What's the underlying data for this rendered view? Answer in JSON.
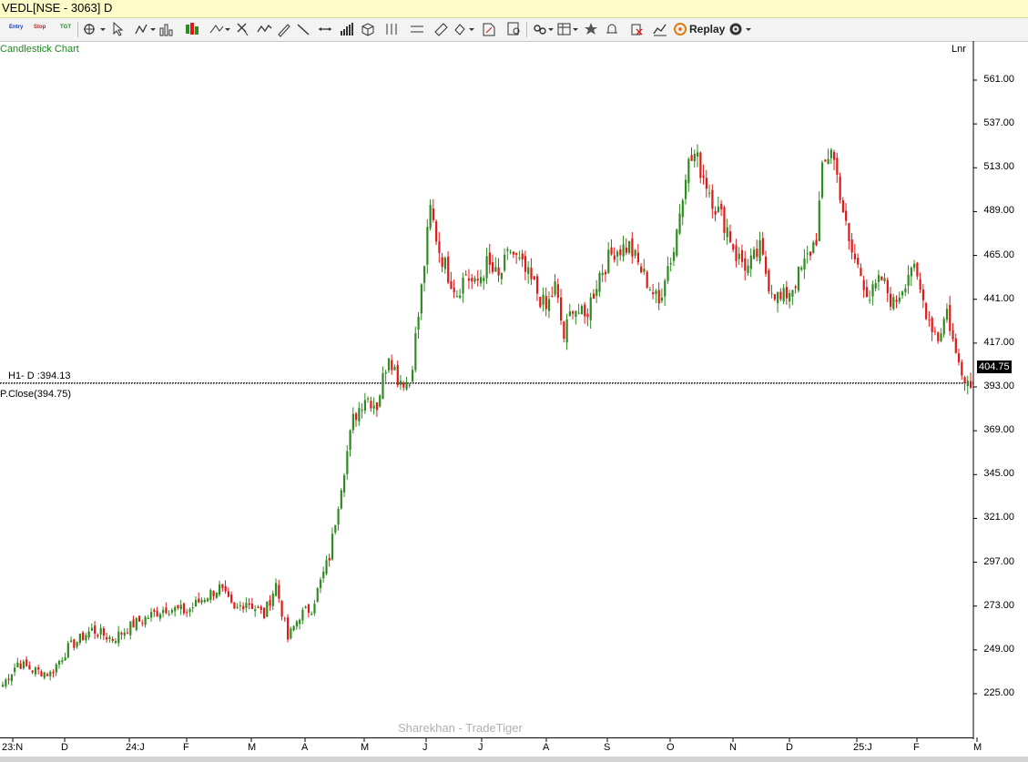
{
  "window": {
    "title": "VEDL[NSE - 3063] D"
  },
  "toolbar": {
    "buttons": [
      {
        "name": "entry-button",
        "label": "Entry",
        "color": "#1c3fa6"
      },
      {
        "name": "stop-button",
        "label": "Stop",
        "color": "#c62020"
      },
      {
        "name": "tgt-button",
        "label": "TGT",
        "color": "#1c8c2a"
      }
    ],
    "icons": [
      "crosshair-icon",
      "pointer-icon",
      "bar-type-icon",
      "chart-bars-icon",
      "candles-icon",
      "line-tools-icon",
      "cursor-icon",
      "zigzag-icon",
      "pencil-icon",
      "trendline-icon",
      "horizontal-line-icon",
      "volume-icon",
      "cube-icon",
      "fibonacci-icon",
      "parallel-lines-icon",
      "ruler-icon",
      "paint-icon",
      "text-tool-icon",
      "zoom-icon",
      "link-icon",
      "layout-icon",
      "favorite-icon",
      "alert-icon",
      "delete-icon",
      "indicator-icon"
    ],
    "replay_label": "Replay"
  },
  "chart": {
    "title": "Candlestick Chart",
    "scale_mode": "Lnr",
    "last_price": "404.75",
    "hline_label": "H1- D :394.13",
    "pclose_label": "P.Close(394.75)",
    "watermark": "Sharekhan - TradeTiger",
    "up_color": "#2e8b20",
    "down_color": "#e01818"
  },
  "chart_data": {
    "type": "candlestick",
    "title": "Candlestick Chart",
    "y_ticks": [
      "561.00",
      "537.00",
      "513.00",
      "489.00",
      "465.00",
      "441.00",
      "417.00",
      "393.00",
      "369.00",
      "345.00",
      "321.00",
      "297.00",
      "273.00",
      "249.00",
      "225.00"
    ],
    "ylim": [
      209,
      575
    ],
    "x_ticks": [
      "23:N",
      "D",
      "24:J",
      "F",
      "M",
      "A",
      "M",
      "J",
      "J",
      "A",
      "S",
      "O",
      "N",
      "D",
      "25:J",
      "F",
      "M"
    ],
    "last_price": 404.75,
    "h1_level": 394.13,
    "previous_close": 394.75,
    "anchors": [
      [
        0,
        230
      ],
      [
        5,
        242
      ],
      [
        10,
        238
      ],
      [
        16,
        236
      ],
      [
        22,
        250
      ],
      [
        30,
        260
      ],
      [
        37,
        255
      ],
      [
        44,
        263
      ],
      [
        50,
        268
      ],
      [
        55,
        272
      ],
      [
        62,
        270
      ],
      [
        68,
        278
      ],
      [
        73,
        283
      ],
      [
        78,
        270
      ],
      [
        82,
        276
      ],
      [
        88,
        268
      ],
      [
        92,
        285
      ],
      [
        96,
        255
      ],
      [
        100,
        268
      ],
      [
        104,
        272
      ],
      [
        110,
        300
      ],
      [
        114,
        340
      ],
      [
        118,
        375
      ],
      [
        122,
        388
      ],
      [
        126,
        383
      ],
      [
        130,
        412
      ],
      [
        133,
        398
      ],
      [
        137,
        395
      ],
      [
        140,
        432
      ],
      [
        144,
        490
      ],
      [
        147,
        468
      ],
      [
        150,
        455
      ],
      [
        153,
        445
      ],
      [
        156,
        455
      ],
      [
        159,
        448
      ],
      [
        163,
        460
      ],
      [
        167,
        452
      ],
      [
        171,
        468
      ],
      [
        175,
        458
      ],
      [
        179,
        448
      ],
      [
        183,
        435
      ],
      [
        186,
        448
      ],
      [
        189,
        420
      ],
      [
        192,
        438
      ],
      [
        196,
        430
      ],
      [
        201,
        455
      ],
      [
        206,
        468
      ],
      [
        211,
        470
      ],
      [
        214,
        460
      ],
      [
        218,
        448
      ],
      [
        221,
        438
      ],
      [
        223,
        455
      ],
      [
        226,
        468
      ],
      [
        230,
        512
      ],
      [
        233,
        520
      ],
      [
        237,
        505
      ],
      [
        240,
        492
      ],
      [
        244,
        480
      ],
      [
        247,
        465
      ],
      [
        251,
        458
      ],
      [
        255,
        468
      ],
      [
        258,
        450
      ],
      [
        262,
        440
      ],
      [
        266,
        448
      ],
      [
        270,
        460
      ],
      [
        274,
        475
      ],
      [
        276,
        510
      ],
      [
        279,
        525
      ],
      [
        282,
        500
      ],
      [
        285,
        470
      ],
      [
        289,
        455
      ],
      [
        292,
        442
      ],
      [
        296,
        452
      ],
      [
        300,
        438
      ],
      [
        303,
        448
      ],
      [
        306,
        460
      ],
      [
        309,
        445
      ],
      [
        312,
        430
      ],
      [
        315,
        420
      ],
      [
        318,
        435
      ],
      [
        321,
        410
      ],
      [
        324,
        400
      ],
      [
        326,
        393
      ]
    ],
    "anchor_note": "Daily closes approximated as [trading-day index, price]; individual candles are interpolated between these readings."
  }
}
